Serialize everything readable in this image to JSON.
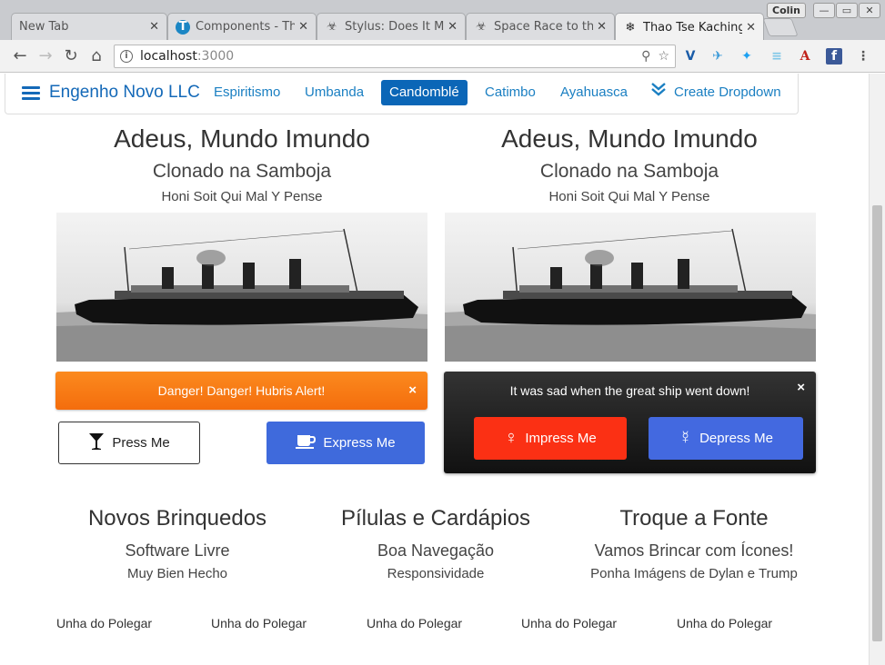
{
  "browser": {
    "tabs": [
      {
        "title": "New Tab",
        "icon": "none"
      },
      {
        "title": "Components - Th",
        "icon": "T"
      },
      {
        "title": "Stylus: Does It M",
        "icon": "biohazard"
      },
      {
        "title": "Space Race to th",
        "icon": "biohazard"
      },
      {
        "title": "Thao Tse Kaching",
        "icon": "snowflake"
      }
    ],
    "profile": "Colin",
    "url_host": "localhost",
    "url_port": ":3000"
  },
  "navbar": {
    "brand": "Engenho Novo LLC",
    "links": [
      "Espiritismo",
      "Umbanda",
      "Candomblé",
      "Catimbo",
      "Ayahuasca"
    ],
    "active_link": "Candomblé",
    "dropdown_label": "Create Dropdown"
  },
  "left_card": {
    "title": "Adeus, Mundo Imundo",
    "subtitle": "Clonado na Samboja",
    "tagline": "Honi Soit Qui Mal Y Pense",
    "alert": "Danger! Danger! Hubris Alert!",
    "alert_close": "×",
    "button_press": "Press Me",
    "button_express": "Express Me"
  },
  "right_card": {
    "title": "Adeus, Mundo Imundo",
    "subtitle": "Clonado na Samboja",
    "tagline": "Honi Soit Qui Mal Y Pense",
    "panel_message": "It was sad when the great ship went down!",
    "panel_close": "×",
    "button_impress": "Impress Me",
    "button_depress": "Depress Me"
  },
  "columns": [
    {
      "title": "Novos Brinquedos",
      "subtitle": "Software Livre",
      "small": "Muy Bien Hecho"
    },
    {
      "title": "Pílulas e Cardápios",
      "subtitle": "Boa Navegação",
      "small": "Responsividade"
    },
    {
      "title": "Troque a Fonte",
      "subtitle": "Vamos Brincar com Ícones!",
      "small": "Ponha Imágens de Dylan e Trump"
    }
  ],
  "thumbnails": [
    "Unha do Polegar",
    "Unha do Polegar",
    "Unha do Polegar",
    "Unha do Polegar",
    "Unha do Polegar"
  ],
  "colors": {
    "brand_blue": "#1469b8",
    "active_nav": "#0b66b7",
    "alert_orange": "#f67b14",
    "button_blue": "#3f6adc",
    "button_red": "#fb3014",
    "dark_panel": "#1e1e1e"
  }
}
